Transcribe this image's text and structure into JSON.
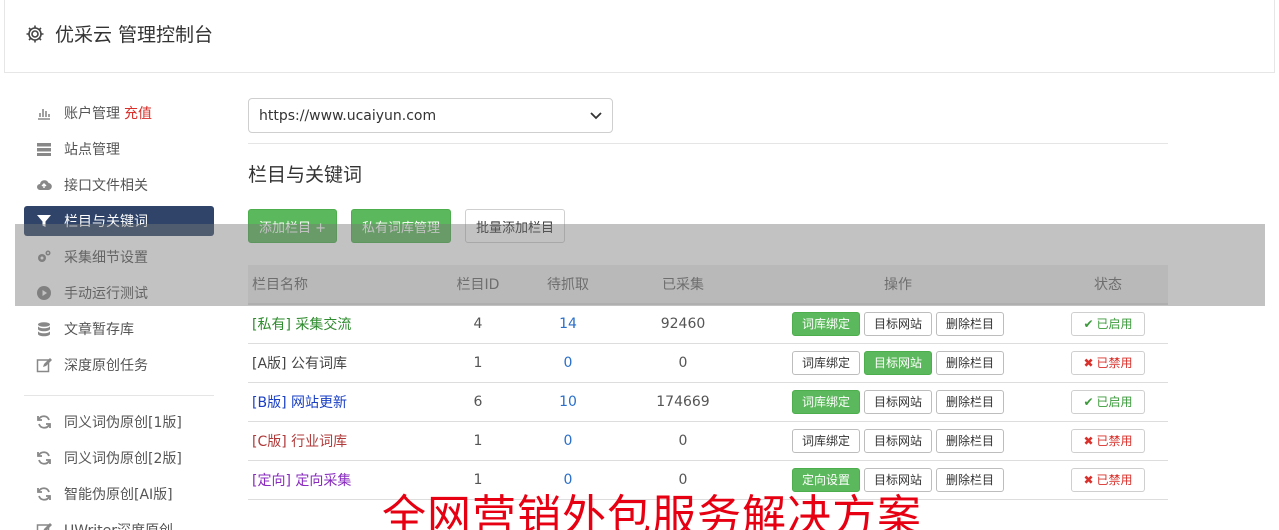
{
  "header": {
    "title": "优采云 管理控制台",
    "icon": "gear-icon"
  },
  "sidebar": {
    "items": [
      {
        "label": "账户管理",
        "extra": "充值",
        "icon": "bar-chart-icon"
      },
      {
        "label": "站点管理",
        "icon": "server-icon"
      },
      {
        "label": "接口文件相关",
        "icon": "cloud-upload-icon"
      },
      {
        "label": "栏目与关键词",
        "icon": "filter-icon",
        "active": true
      },
      {
        "label": "采集细节设置",
        "icon": "cogs-icon"
      },
      {
        "label": "手动运行测试",
        "icon": "play-circle-icon"
      },
      {
        "label": "文章暂存库",
        "icon": "database-icon"
      },
      {
        "label": "深度原创任务",
        "icon": "edit-icon"
      }
    ],
    "items2": [
      {
        "label": "同义词伪原创[1版]",
        "icon": "refresh-icon"
      },
      {
        "label": "同义词伪原创[2版]",
        "icon": "refresh-icon"
      },
      {
        "label": "智能伪原创[AI版]",
        "icon": "refresh-icon"
      },
      {
        "label": "UWriter深度原创",
        "icon": "edit-icon"
      }
    ]
  },
  "site_select": {
    "value": "https://www.ucaiyun.com"
  },
  "section": {
    "title": "栏目与关键词",
    "buttons": {
      "add": "添加栏目 +",
      "private": "私有词库管理",
      "batch": "批量添加栏目"
    }
  },
  "table": {
    "headers": [
      "栏目名称",
      "栏目ID",
      "待抓取",
      "已采集",
      "操作",
      "状态"
    ],
    "rows": [
      {
        "tag": "[私有]",
        "name": "采集交流",
        "id": "4",
        "wait": "14",
        "done": "92460",
        "op1": "词库绑定",
        "op2": "目标网站",
        "op3": "删除栏目",
        "status": "已启用"
      },
      {
        "tag": "[A版]",
        "name": "公有词库",
        "id": "1",
        "wait": "0",
        "done": "0",
        "op1": "词库绑定",
        "op2": "目标网站",
        "op3": "删除栏目",
        "status": "已禁用"
      },
      {
        "tag": "[B版]",
        "name": "网站更新",
        "id": "6",
        "wait": "10",
        "done": "174669",
        "op1": "词库绑定",
        "op2": "目标网站",
        "op3": "删除栏目",
        "status": "已启用"
      },
      {
        "tag": "[C版]",
        "name": "行业词库",
        "id": "1",
        "wait": "0",
        "done": "0",
        "op1": "词库绑定",
        "op2": "目标网站",
        "op3": "删除栏目",
        "status": "已禁用"
      },
      {
        "tag": "[定向]",
        "name": "定向采集",
        "id": "1",
        "wait": "0",
        "done": "0",
        "op1": "定向设置",
        "op2": "目标网站",
        "op3": "删除栏目",
        "status": "已禁用"
      }
    ]
  },
  "watermark": "全网营销外包服务解决方案",
  "colors": {
    "accent_green": "#5cb85c",
    "nav_active": "#2f4468",
    "danger": "#d9302b",
    "link_blue": "#2a6fc9"
  }
}
